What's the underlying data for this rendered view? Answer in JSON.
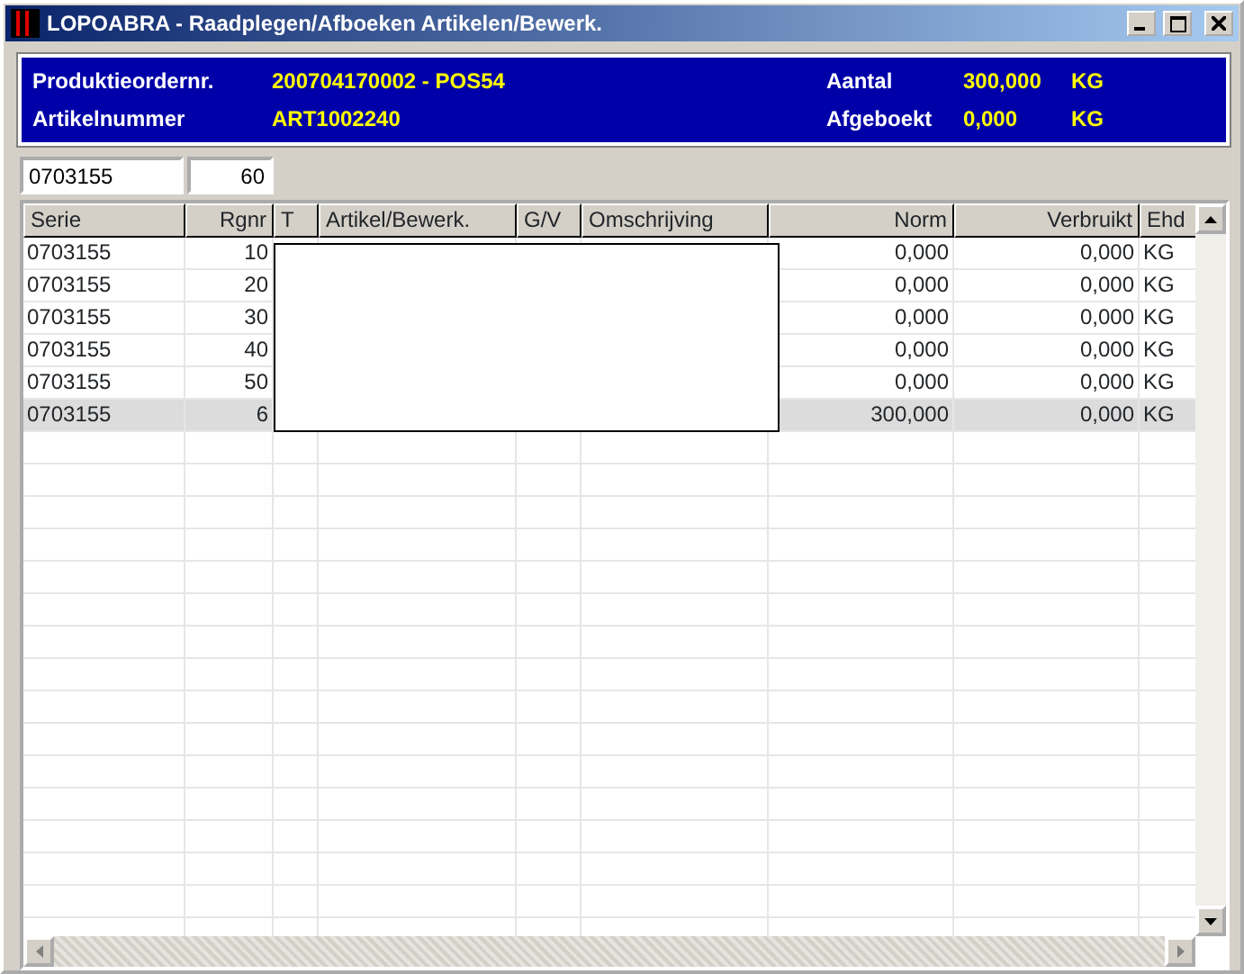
{
  "window": {
    "title": "LOPOABRA - Raadplegen/Afboeken Artikelen/Bewerk."
  },
  "info_panel": [
    {
      "label": "Produktieordernr.",
      "value": "200704170002 - POS54"
    },
    {
      "label": "Aantal",
      "value": "300,000",
      "unit": "KG"
    },
    {
      "label": "Artikelnummer",
      "value": "ART1002240"
    },
    {
      "label": "Afgeboekt",
      "value": "0,000",
      "unit": "KG"
    }
  ],
  "serie_field": {
    "value": "0703155"
  },
  "rgnr_field": {
    "value": "60"
  },
  "table": {
    "columns": [
      "Serie",
      "Rgnr",
      "T",
      "Artikel/Bewerk.",
      "G/V",
      "Omschrijving",
      "Norm",
      "Verbruikt",
      "Ehd"
    ],
    "rows": [
      {
        "serie": "0703155",
        "rgnr": "10",
        "norm": "0,000",
        "verbruikt": "0,000",
        "ehd": "KG",
        "selected": false
      },
      {
        "serie": "0703155",
        "rgnr": "20",
        "norm": "0,000",
        "verbruikt": "0,000",
        "ehd": "KG",
        "selected": false
      },
      {
        "serie": "0703155",
        "rgnr": "30",
        "norm": "0,000",
        "verbruikt": "0,000",
        "ehd": "KG",
        "selected": false
      },
      {
        "serie": "0703155",
        "rgnr": "40",
        "norm": "0,000",
        "verbruikt": "0,000",
        "ehd": "KG",
        "selected": false
      },
      {
        "serie": "0703155",
        "rgnr": "50",
        "norm": "0,000",
        "verbruikt": "0,000",
        "ehd": "KG",
        "selected": false
      },
      {
        "serie": "0703155",
        "rgnr": "6",
        "norm": "300,000",
        "verbruikt": "0,000",
        "ehd": "KG",
        "selected": true
      }
    ]
  }
}
